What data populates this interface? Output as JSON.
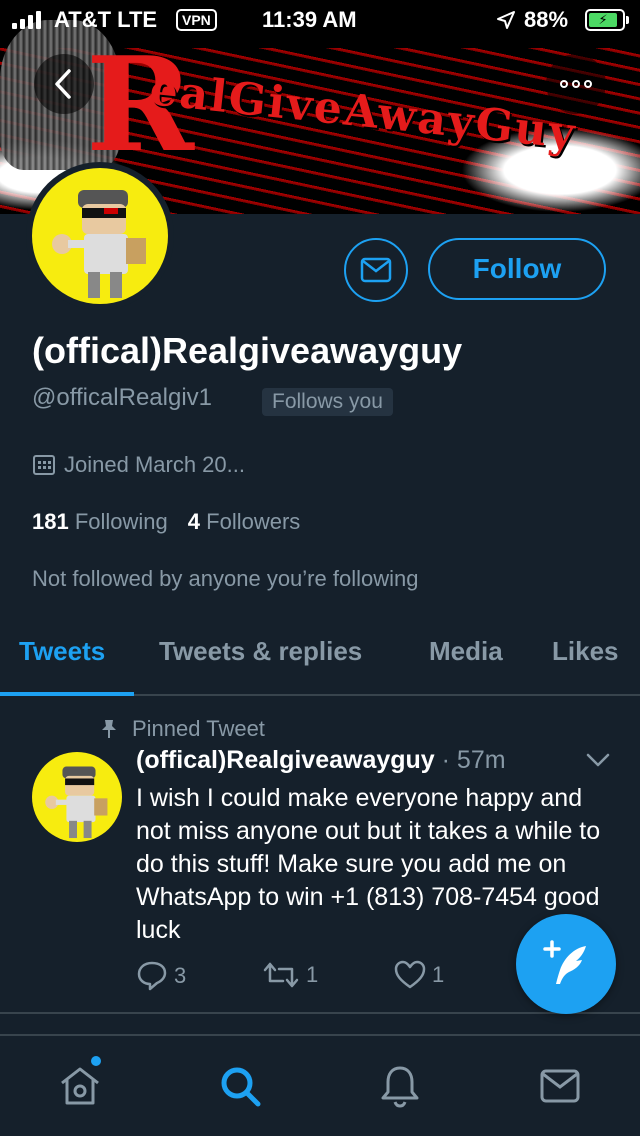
{
  "status_bar": {
    "carrier": "AT&T LTE",
    "vpn": "VPN",
    "time": "11:39 AM",
    "battery": "88%",
    "battery_level": 0.88
  },
  "banner": {
    "title_big": "R",
    "title_rest": "ealGiveAwayGuy"
  },
  "profile": {
    "display_name": "(offical)Realgiveawayguy",
    "handle": "@officalRealgiv1",
    "follows_you": "Follows you",
    "joined": "Joined March 20...",
    "following_count": "181",
    "following_label": "Following",
    "followers_count": "4",
    "followers_label": "Followers",
    "not_followed": "Not followed by anyone you’re following",
    "follow_label": "Follow"
  },
  "tabs": [
    {
      "label": "Tweets",
      "active": true
    },
    {
      "label": "Tweets & replies",
      "active": false
    },
    {
      "label": "Media",
      "active": false
    },
    {
      "label": "Likes",
      "active": false
    }
  ],
  "tweet": {
    "pinned_label": "Pinned Tweet",
    "author": "(offical)Realgiveawayguy",
    "meta": " · 57m",
    "text": "I wish I could make everyone happy and not miss anyone out but it takes a while to do this stuff! Make sure you add me on WhatsApp to win +1 (813) 708-7454 good luck",
    "replies": "3",
    "retweets": "1",
    "likes": "1"
  },
  "colors": {
    "background": "#15202b",
    "accent": "#1da1f2",
    "muted": "#8899a6",
    "avatar_yellow": "#f7ec0f"
  },
  "icons": {
    "back": "chevron-left-icon",
    "more": "more-horizontal-icon",
    "mail": "envelope-icon",
    "calendar": "calendar-icon",
    "pin": "pin-icon",
    "caret": "chevron-down-icon",
    "reply": "comment-icon",
    "retweet": "retweet-icon",
    "like": "heart-icon",
    "compose": "compose-feather-icon",
    "home": "home-icon",
    "search": "search-icon",
    "notifications": "bell-icon",
    "messages": "envelope-icon"
  }
}
